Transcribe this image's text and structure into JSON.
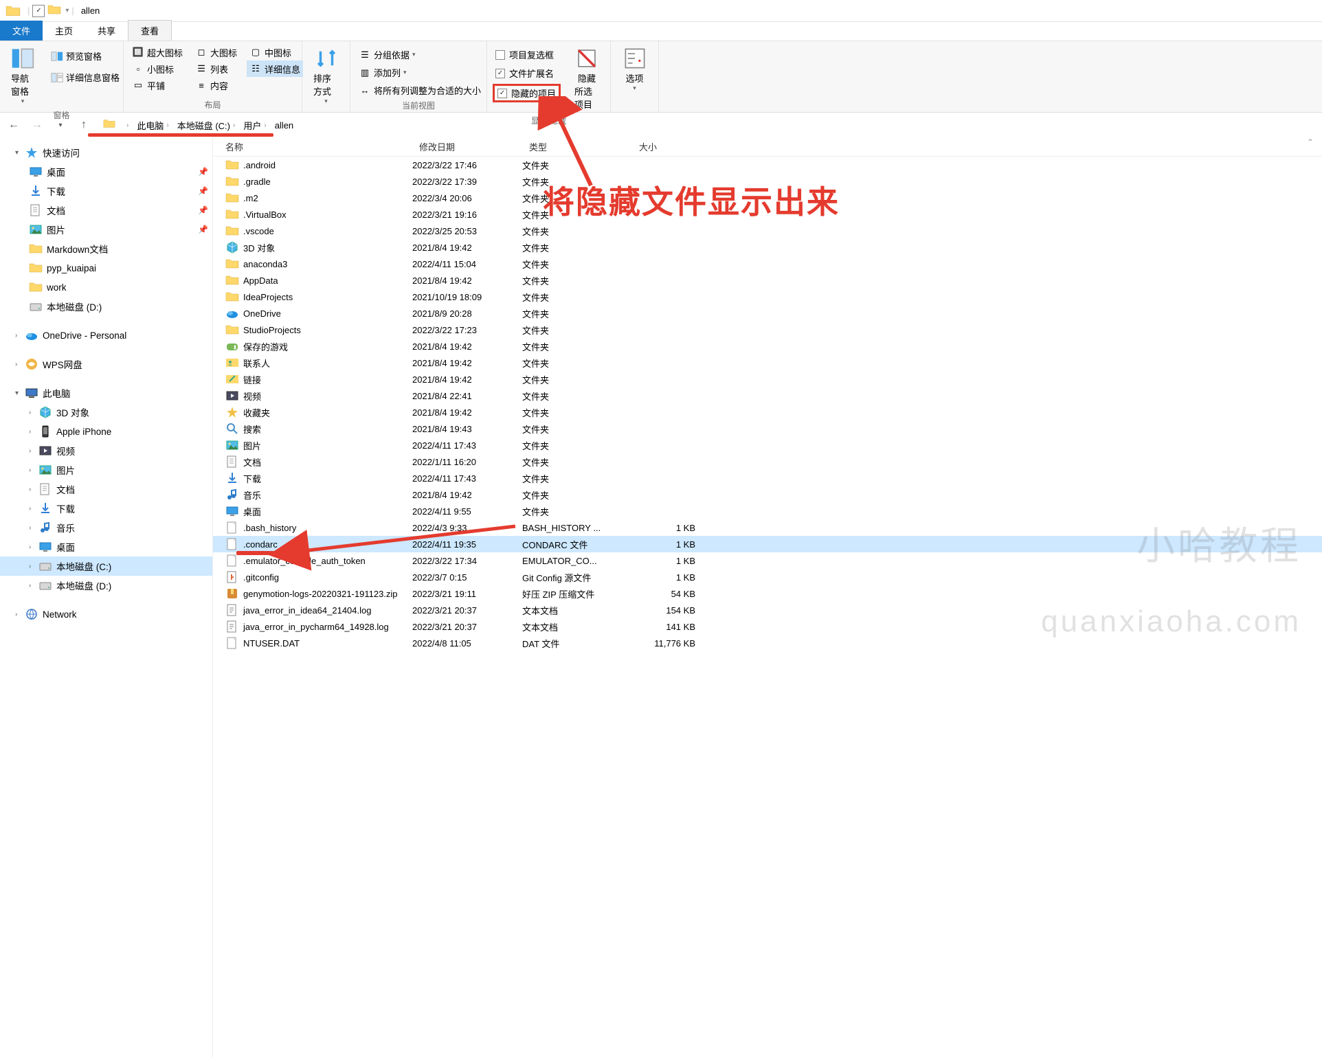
{
  "window_title": "allen",
  "tabs": {
    "file": "文件",
    "home": "主页",
    "share": "共享",
    "view": "查看"
  },
  "ribbon": {
    "pane": {
      "nav": "导航窗格",
      "preview": "预览窗格",
      "details": "详细信息窗格",
      "label": "窗格"
    },
    "layout": {
      "xl": "超大图标",
      "lg": "大图标",
      "md": "中图标",
      "sm": "小图标",
      "list": "列表",
      "details": "详细信息",
      "tile": "平铺",
      "content": "内容",
      "label": "布局"
    },
    "sort": "排序方式",
    "curview": {
      "group": "分组依据",
      "addcol": "添加列",
      "fit": "将所有列调整为合适的大小",
      "label": "当前视图"
    },
    "showhide": {
      "checkboxes": "项目复选框",
      "ext": "文件扩展名",
      "hidden": "隐藏的项目",
      "hidesel_l1": "隐藏",
      "hidesel_l2": "所选项目",
      "label": "显示/隐藏"
    },
    "options": "选项"
  },
  "breadcrumbs": [
    "此电脑",
    "本地磁盘 (C:)",
    "用户",
    "allen"
  ],
  "columns": {
    "name": "名称",
    "date": "修改日期",
    "type": "类型",
    "size": "大小"
  },
  "nav": {
    "quick": "快速访问",
    "quick_items": [
      {
        "name": "桌面",
        "pin": true,
        "ico": "desktop"
      },
      {
        "name": "下载",
        "pin": true,
        "ico": "download"
      },
      {
        "name": "文档",
        "pin": true,
        "ico": "doc"
      },
      {
        "name": "图片",
        "pin": true,
        "ico": "pic"
      },
      {
        "name": "Markdown文档",
        "ico": "folder"
      },
      {
        "name": "pyp_kuaipai",
        "ico": "folder"
      },
      {
        "name": "work",
        "ico": "folder"
      },
      {
        "name": "本地磁盘 (D:)",
        "ico": "drive"
      }
    ],
    "onedrive": "OneDrive - Personal",
    "wps": "WPS网盘",
    "thispc": "此电脑",
    "pc_items": [
      {
        "name": "3D 对象",
        "ico": "3d"
      },
      {
        "name": "Apple iPhone",
        "ico": "phone"
      },
      {
        "name": "视频",
        "ico": "video"
      },
      {
        "name": "图片",
        "ico": "pic"
      },
      {
        "name": "文档",
        "ico": "doc"
      },
      {
        "name": "下载",
        "ico": "download"
      },
      {
        "name": "音乐",
        "ico": "music"
      },
      {
        "name": "桌面",
        "ico": "desktop"
      },
      {
        "name": "本地磁盘 (C:)",
        "ico": "drive",
        "sel": true
      },
      {
        "name": "本地磁盘 (D:)",
        "ico": "drive"
      }
    ],
    "network": "Network"
  },
  "files": [
    {
      "name": ".android",
      "date": "2022/3/22 17:46",
      "type": "文件夹",
      "size": "",
      "ico": "folder"
    },
    {
      "name": ".gradle",
      "date": "2022/3/22 17:39",
      "type": "文件夹",
      "size": "",
      "ico": "folder"
    },
    {
      "name": ".m2",
      "date": "2022/3/4 20:06",
      "type": "文件夹",
      "size": "",
      "ico": "folder"
    },
    {
      "name": ".VirtualBox",
      "date": "2022/3/21 19:16",
      "type": "文件夹",
      "size": "",
      "ico": "folder"
    },
    {
      "name": ".vscode",
      "date": "2022/3/25 20:53",
      "type": "文件夹",
      "size": "",
      "ico": "folder"
    },
    {
      "name": "3D 对象",
      "date": "2021/8/4 19:42",
      "type": "文件夹",
      "size": "",
      "ico": "3d"
    },
    {
      "name": "anaconda3",
      "date": "2022/4/11 15:04",
      "type": "文件夹",
      "size": "",
      "ico": "folder"
    },
    {
      "name": "AppData",
      "date": "2021/8/4 19:42",
      "type": "文件夹",
      "size": "",
      "ico": "folder"
    },
    {
      "name": "IdeaProjects",
      "date": "2021/10/19 18:09",
      "type": "文件夹",
      "size": "",
      "ico": "folder"
    },
    {
      "name": "OneDrive",
      "date": "2021/8/9 20:28",
      "type": "文件夹",
      "size": "",
      "ico": "onedrive"
    },
    {
      "name": "StudioProjects",
      "date": "2022/3/22 17:23",
      "type": "文件夹",
      "size": "",
      "ico": "folder"
    },
    {
      "name": "保存的游戏",
      "date": "2021/8/4 19:42",
      "type": "文件夹",
      "size": "",
      "ico": "games"
    },
    {
      "name": "联系人",
      "date": "2021/8/4 19:42",
      "type": "文件夹",
      "size": "",
      "ico": "contacts"
    },
    {
      "name": "链接",
      "date": "2021/8/4 19:42",
      "type": "文件夹",
      "size": "",
      "ico": "links"
    },
    {
      "name": "视频",
      "date": "2021/8/4 22:41",
      "type": "文件夹",
      "size": "",
      "ico": "video"
    },
    {
      "name": "收藏夹",
      "date": "2021/8/4 19:42",
      "type": "文件夹",
      "size": "",
      "ico": "fav"
    },
    {
      "name": "搜索",
      "date": "2021/8/4 19:43",
      "type": "文件夹",
      "size": "",
      "ico": "search"
    },
    {
      "name": "图片",
      "date": "2022/4/11 17:43",
      "type": "文件夹",
      "size": "",
      "ico": "pic"
    },
    {
      "name": "文档",
      "date": "2022/1/11 16:20",
      "type": "文件夹",
      "size": "",
      "ico": "doc"
    },
    {
      "name": "下载",
      "date": "2022/4/11 17:43",
      "type": "文件夹",
      "size": "",
      "ico": "download"
    },
    {
      "name": "音乐",
      "date": "2021/8/4 19:42",
      "type": "文件夹",
      "size": "",
      "ico": "music"
    },
    {
      "name": "桌面",
      "date": "2022/4/11 9:55",
      "type": "文件夹",
      "size": "",
      "ico": "desktop"
    },
    {
      "name": ".bash_history",
      "date": "2022/4/3 9:33",
      "type": "BASH_HISTORY ...",
      "size": "1 KB",
      "ico": "file"
    },
    {
      "name": ".condarc",
      "date": "2022/4/11 19:35",
      "type": "CONDARC 文件",
      "size": "1 KB",
      "ico": "file",
      "sel": true
    },
    {
      "name": ".emulator_console_auth_token",
      "date": "2022/3/22 17:34",
      "type": "EMULATOR_CO...",
      "size": "1 KB",
      "ico": "file"
    },
    {
      "name": ".gitconfig",
      "date": "2022/3/7 0:15",
      "type": "Git Config 源文件",
      "size": "1 KB",
      "ico": "git"
    },
    {
      "name": "genymotion-logs-20220321-191123.zip",
      "date": "2022/3/21 19:11",
      "type": "好压 ZIP 压缩文件",
      "size": "54 KB",
      "ico": "zip"
    },
    {
      "name": "java_error_in_idea64_21404.log",
      "date": "2022/3/21 20:37",
      "type": "文本文档",
      "size": "154 KB",
      "ico": "txt"
    },
    {
      "name": "java_error_in_pycharm64_14928.log",
      "date": "2022/3/21 20:37",
      "type": "文本文档",
      "size": "141 KB",
      "ico": "txt"
    },
    {
      "name": "NTUSER.DAT",
      "date": "2022/4/8 11:05",
      "type": "DAT 文件",
      "size": "11,776 KB",
      "ico": "file"
    }
  ],
  "annotation": "将隐藏文件显示出来",
  "watermark1": "小哈教程",
  "watermark2": "quanxiaoha.com"
}
